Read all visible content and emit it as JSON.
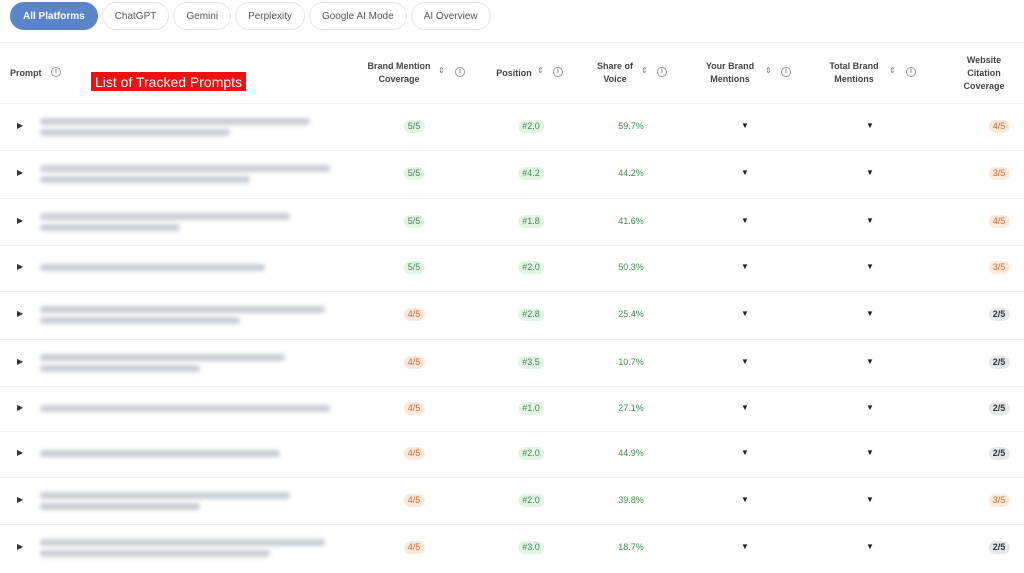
{
  "tabs": [
    "All Platforms",
    "ChatGPT",
    "Gemini",
    "Perplexity",
    "Google AI Mode",
    "AI Overview"
  ],
  "active_tab": 0,
  "columns": {
    "prompt": "Prompt",
    "brand_mention_coverage": "Brand Mention\nCoverage",
    "position": "Position",
    "share_of_voice": "Share of\nVoice",
    "your_brand_mentions": "Your Brand\nMentions",
    "total_brand_mentions": "Total Brand\nMentions",
    "website_citation_coverage": "Website\nCitation\nCoverage"
  },
  "annotation": "List of Tracked Prompts",
  "rows": [
    {
      "coverage": "5/5",
      "coverage_tone": "green",
      "position": "#2.0",
      "sov": "59.7%",
      "citation": "4/5",
      "citation_tone": "orange"
    },
    {
      "coverage": "5/5",
      "coverage_tone": "green",
      "position": "#4.2",
      "sov": "44.2%",
      "citation": "3/5",
      "citation_tone": "orange"
    },
    {
      "coverage": "5/5",
      "coverage_tone": "green",
      "position": "#1.8",
      "sov": "41.6%",
      "citation": "4/5",
      "citation_tone": "orange"
    },
    {
      "coverage": "5/5",
      "coverage_tone": "green",
      "position": "#2.0",
      "sov": "50.3%",
      "citation": "3/5",
      "citation_tone": "orange"
    },
    {
      "coverage": "4/5",
      "coverage_tone": "orange",
      "position": "#2.8",
      "sov": "25.4%",
      "citation": "2/5",
      "citation_tone": "gray"
    },
    {
      "coverage": "4/5",
      "coverage_tone": "orange",
      "position": "#3.5",
      "sov": "10.7%",
      "citation": "2/5",
      "citation_tone": "gray"
    },
    {
      "coverage": "4/5",
      "coverage_tone": "orange",
      "position": "#1.0",
      "sov": "27.1%",
      "citation": "2/5",
      "citation_tone": "gray"
    },
    {
      "coverage": "4/5",
      "coverage_tone": "orange",
      "position": "#2.0",
      "sov": "44.9%",
      "citation": "2/5",
      "citation_tone": "gray"
    },
    {
      "coverage": "4/5",
      "coverage_tone": "orange",
      "position": "#2.0",
      "sov": "39.8%",
      "citation": "3/5",
      "citation_tone": "orange"
    },
    {
      "coverage": "4/5",
      "coverage_tone": "orange",
      "position": "#3.0",
      "sov": "18.7%",
      "citation": "2/5",
      "citation_tone": "gray"
    }
  ],
  "colors": {
    "accent": "#5b84c9",
    "annotation_bg": "#ee1111",
    "green_text": "#3e8a4f",
    "orange_text": "#d36a2f"
  },
  "icons": {
    "info": "info-circle-icon",
    "sort": "sort-icon",
    "expand": "chevron-right-icon",
    "dropdown": "caret-down-icon"
  }
}
